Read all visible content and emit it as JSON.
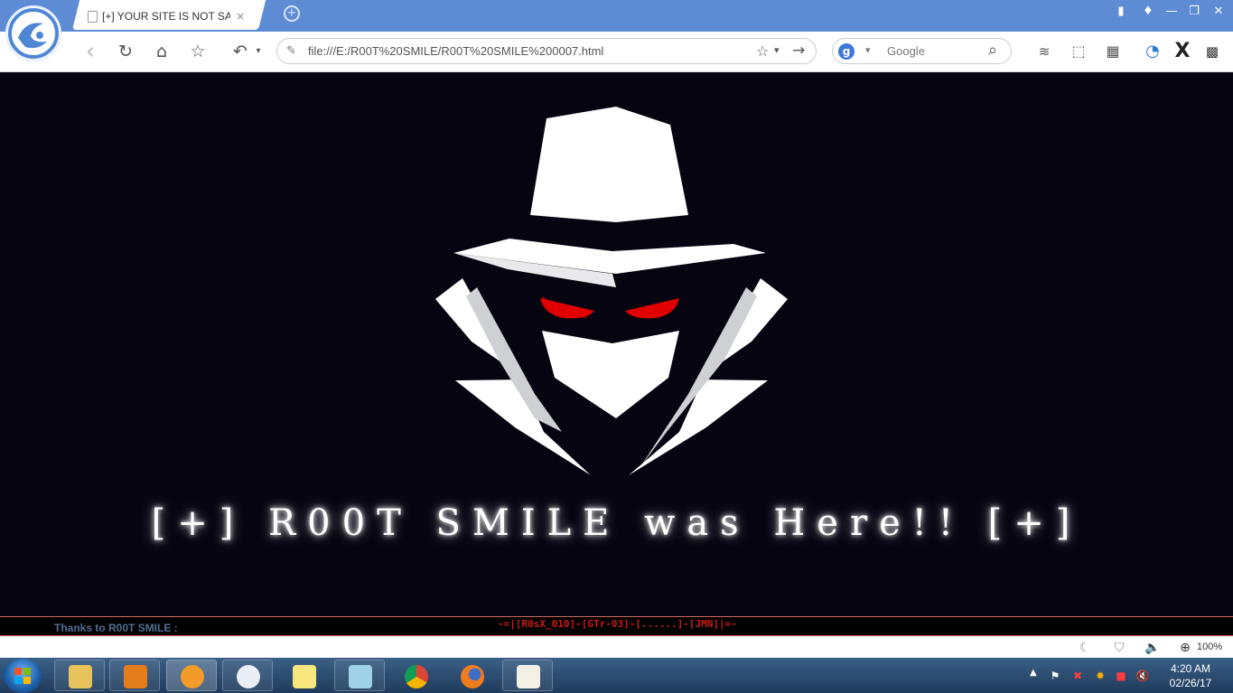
{
  "browser": {
    "tab": {
      "title": "[+] YOUR SITE IS NOT SAF",
      "close": "×"
    },
    "new_tab": "+",
    "window_controls": {
      "minimize": "—",
      "restore": "❐",
      "close": "✕"
    },
    "toolbar": {
      "back": "‹",
      "reload": "↻",
      "home": "⌂",
      "favorite": "☆",
      "undo": "↶",
      "address": "file:///E:/R00T%20SMILE/R00T%20SMILE%200007.html",
      "bookmark_star": "☆",
      "dropdown": "▾",
      "go": "→",
      "search_engine": "g",
      "search_placeholder": "Google",
      "search_icon": "⌕"
    }
  },
  "page": {
    "headline": "[+] R00T SMILE was Here!! [+]",
    "footer": {
      "thanks": "Thanks to R00T SMILE :",
      "crew": "-=|[R0sX_010]-[GTr-03]-[......]-[JMN]|=-"
    },
    "colors": {
      "background": "#050410",
      "eyes": "#e00000",
      "mask": "#ffffff",
      "collar_shade": "#cfd0d4"
    }
  },
  "statusbar": {
    "zoom": "100%"
  },
  "taskbar": {
    "clock": {
      "time": "4:20 AM",
      "date": "02/26/17"
    },
    "apps": [
      "explorer-icon",
      "media-player-icon",
      "uc-browser-icon",
      "paint-icon",
      "sticky-notes-icon",
      "notepad-icon",
      "chrome-icon",
      "firefox-icon",
      "text-editor-icon"
    ]
  }
}
